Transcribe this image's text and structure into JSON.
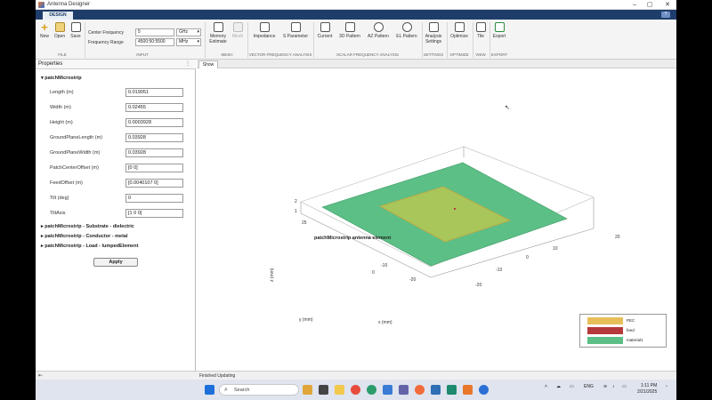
{
  "window": {
    "title": "Antenna Designer",
    "minimize": "–",
    "maximize": "▢",
    "close": "✕"
  },
  "tabs": {
    "design": "DESIGN",
    "help": "?"
  },
  "ribbon": {
    "file": {
      "new": "New",
      "open": "Open",
      "save": "Save",
      "group": "FILE"
    },
    "input": {
      "center_frequency_label": "Center Frequency",
      "center_frequency_value": "5",
      "center_frequency_unit": "GHz",
      "frequency_range_label": "Frequency Range",
      "frequency_range_value": "4500:50:5500",
      "frequency_range_unit": "MHz",
      "group": "INPUT"
    },
    "mesh": {
      "memory_estimate": "Memory",
      "memory_estimate_2": "Estimate",
      "mesh": "Mesh",
      "group": "MESH"
    },
    "vector": {
      "impedance": "Impedance",
      "s_parameter": "S Parameter",
      "group": "VECTOR FREQUENCY ANALYSIS"
    },
    "scalar": {
      "current": "Current",
      "pattern_3d": "3D Pattern",
      "az_pattern": "AZ Pattern",
      "el_pattern": "EL Pattern",
      "group": "SCALAR FREQUENCY ANALYSIS"
    },
    "settings": {
      "analysis": "Analysis",
      "settings": "Settings",
      "group": "SETTINGS"
    },
    "optimize": {
      "label": "Optimize",
      "group": "OPTIMIZE"
    },
    "view": {
      "tile": "Tile",
      "group": "VIEW"
    },
    "export": {
      "label": "Export",
      "group": "EXPORT"
    }
  },
  "properties": {
    "title": "Properties",
    "menu": "⋮",
    "section_main": "patchMicrostrip",
    "fields": [
      {
        "label": "Length (m)",
        "value": "0.019051"
      },
      {
        "label": "Width (m)",
        "value": "0.02455"
      },
      {
        "label": "Height (m)",
        "value": "0.0003928"
      },
      {
        "label": "GroundPlaneLength (m)",
        "value": "0.03928"
      },
      {
        "label": "GroundPlaneWidth (m)",
        "value": "0.03928"
      },
      {
        "label": "PatchCenterOffset (m)",
        "value": "[0 0]"
      },
      {
        "label": "FeedOffset (m)",
        "value": "[0.0040107 0]"
      },
      {
        "label": "Tilt (deg)",
        "value": "0"
      },
      {
        "label": "TiltAxis",
        "value": "[1 0 0]"
      }
    ],
    "collapsed_sections": [
      "patchMicrostrip - Substrate - dielectric",
      "patchMicrostrip - Conductor - metal",
      "patchMicrostrip - Load - lumpedElement"
    ],
    "apply": "Apply"
  },
  "canvas": {
    "tab": "Show",
    "title": "patchMicrostrip antenna element",
    "axis_x": "x (mm)",
    "axis_y": "y (mm)",
    "axis_z": "z (mm)",
    "ticks_x": [
      "-20",
      "-10",
      "0",
      "10",
      "20"
    ],
    "ticks_y": [
      "-20",
      "-10",
      "0",
      "10",
      "20"
    ],
    "ticks_z": [
      "1",
      "2"
    ],
    "tick_y_25": "25",
    "colors": {
      "pec": "#e7bf5a",
      "feed": "#b5383b",
      "material": "#5cbf86",
      "patch": "#a8c65a"
    },
    "legend": [
      {
        "label": "PEC",
        "color": "#e7bf5a"
      },
      {
        "label": "feed",
        "color": "#b5383b"
      },
      {
        "label": "material1",
        "color": "#5cbf86"
      }
    ]
  },
  "status": {
    "text": "Finished Updating",
    "left_icon": "⇤"
  },
  "taskbar": {
    "search": "Search",
    "lang": "ENG",
    "time": "1:11 PM",
    "date": "2/21/2025"
  }
}
